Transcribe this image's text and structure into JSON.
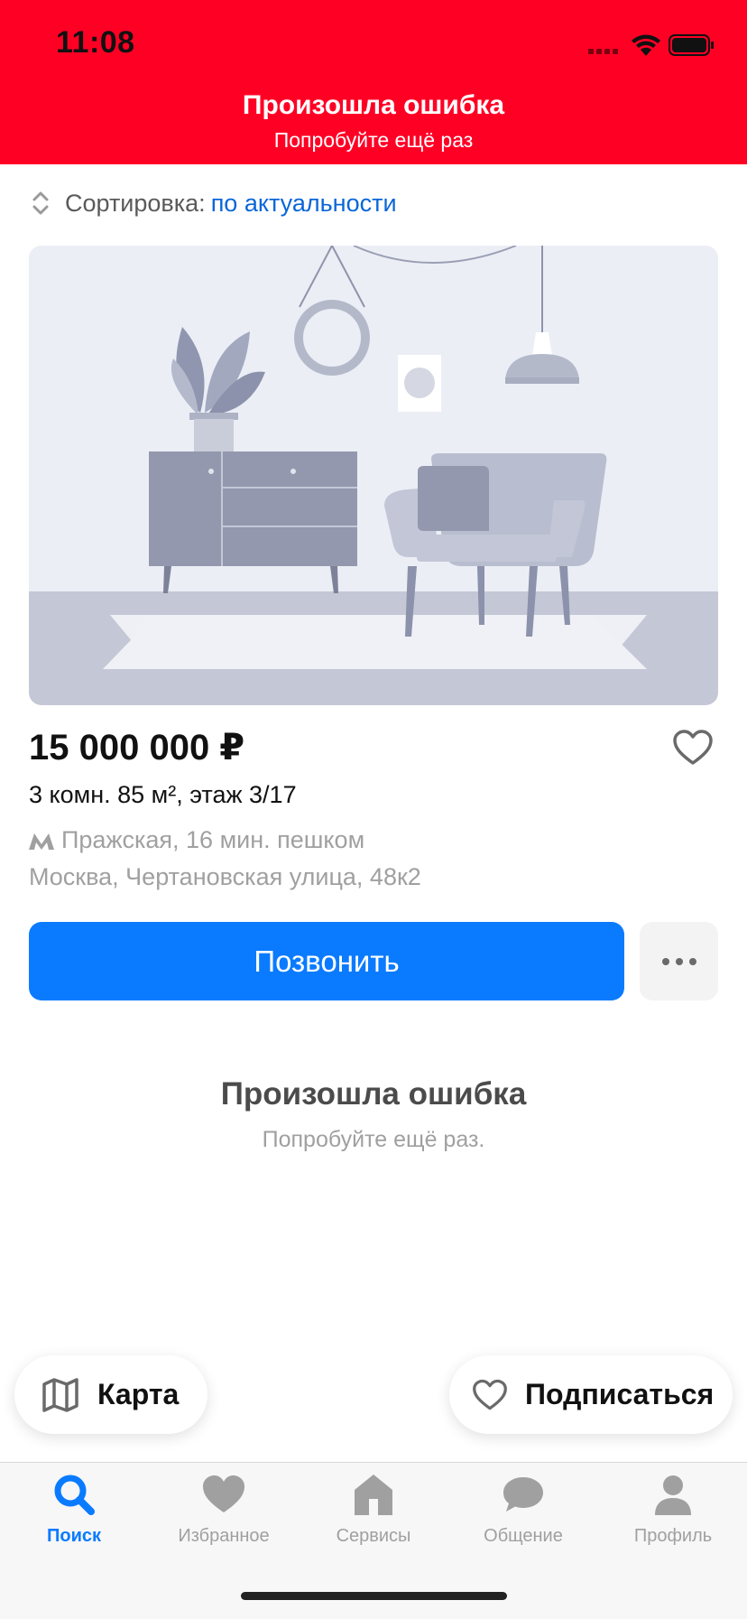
{
  "status_bar": {
    "time": "11:08"
  },
  "banner": {
    "title": "Произошла ошибка",
    "subtitle": "Попробуйте ещё раз"
  },
  "sort": {
    "label": "Сортировка:",
    "value": "по актуальности"
  },
  "listing": {
    "price": "15 000 000 ₽",
    "rooms": "3 комн. 85 м², этаж 3/17",
    "metro": "Пражская, 16 мин. пешком",
    "address": "Москва, Чертановская улица, 48к2"
  },
  "actions": {
    "call_label": "Позвонить"
  },
  "error": {
    "title": "Произошла ошибка",
    "subtitle": "Попробуйте ещё раз."
  },
  "floating": {
    "map_label": "Карта",
    "subscribe_label": "Подписаться"
  },
  "tabs": [
    {
      "label": "Поиск",
      "icon": "search-icon",
      "active": true
    },
    {
      "label": "Избранное",
      "icon": "heart-icon",
      "active": false
    },
    {
      "label": "Сервисы",
      "icon": "house-icon",
      "active": false
    },
    {
      "label": "Общение",
      "icon": "chat-icon",
      "active": false
    },
    {
      "label": "Профиль",
      "icon": "person-icon",
      "active": false
    }
  ],
  "colors": {
    "banner": "#FF0025",
    "accent": "#0A7BFF",
    "link": "#0A66D8"
  }
}
